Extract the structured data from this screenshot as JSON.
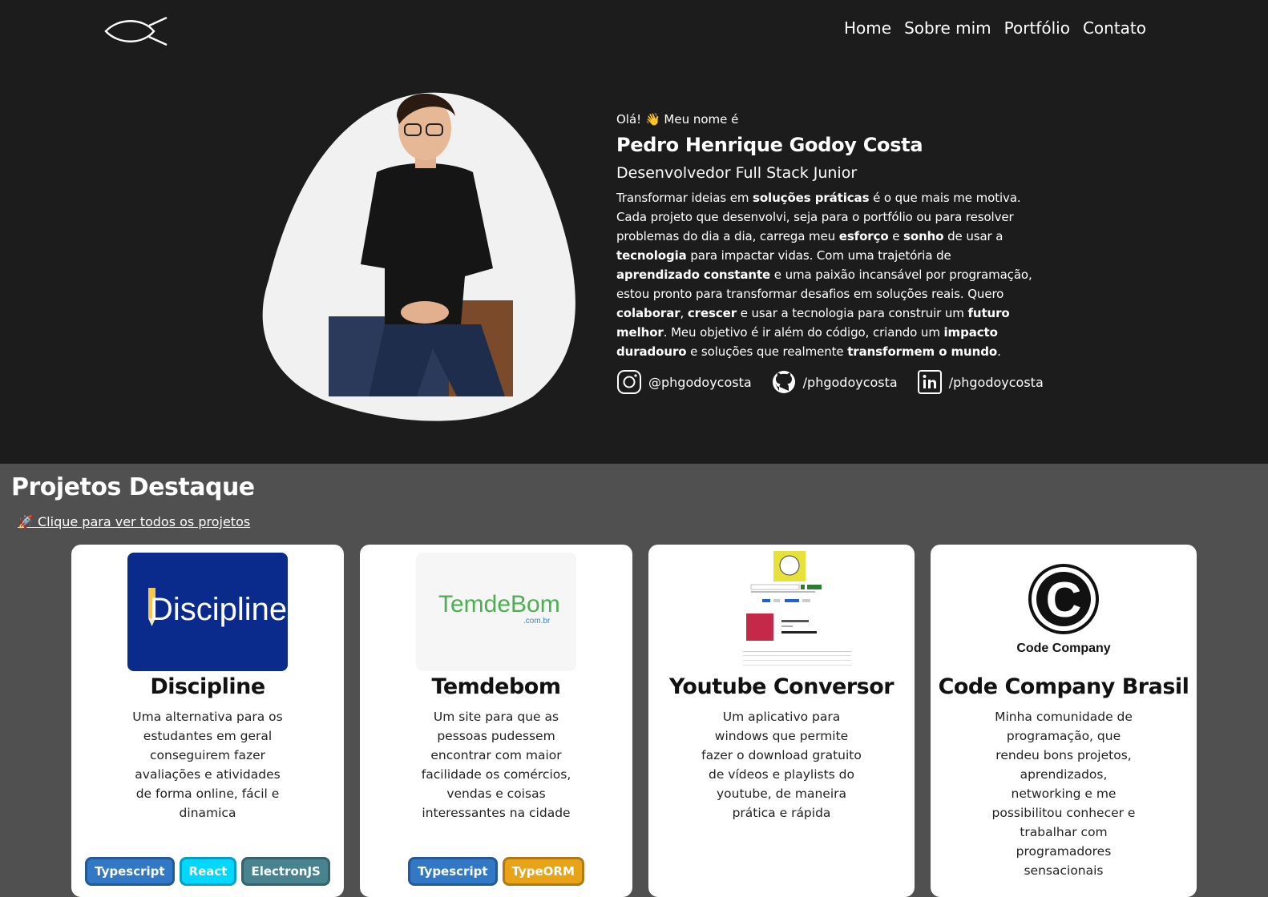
{
  "nav": {
    "items": [
      "Home",
      "Sobre mim",
      "Portfólio",
      "Contato"
    ]
  },
  "hero": {
    "greeting": "Olá! 👋 Meu nome é",
    "name": "Pedro Henrique Godoy Costa",
    "role": "Desenvolvedor Full Stack Junior",
    "bio": [
      {
        "t": "Transformar ideias em "
      },
      {
        "t": "soluções práticas",
        "b": true
      },
      {
        "t": " é o que mais me motiva. Cada projeto que desenvolvi, seja para o portfólio ou para resolver problemas do dia a dia, carrega meu "
      },
      {
        "t": "esforço",
        "b": true
      },
      {
        "t": " e "
      },
      {
        "t": "sonho",
        "b": true
      },
      {
        "t": " de usar a "
      },
      {
        "t": "tecnologia",
        "b": true
      },
      {
        "t": " para impactar vidas. Com uma trajetória de "
      },
      {
        "t": "aprendizado constante",
        "b": true
      },
      {
        "t": " e uma paixão incansável por programação, estou pronto para transformar desafios em soluções reais. Quero "
      },
      {
        "t": "colaborar",
        "b": true
      },
      {
        "t": ", "
      },
      {
        "t": "crescer",
        "b": true
      },
      {
        "t": " e usar a tecnologia para construir um "
      },
      {
        "t": "futuro melhor",
        "b": true
      },
      {
        "t": ". Meu objetivo é ir além do código, criando um "
      },
      {
        "t": "impacto duradouro",
        "b": true
      },
      {
        "t": " e soluções que realmente "
      },
      {
        "t": "transformem o mundo",
        "b": true
      },
      {
        "t": "."
      }
    ],
    "socials": {
      "instagram": "@phgodoycosta",
      "github": "/phgodoycosta",
      "linkedin": "/phgodoycosta"
    }
  },
  "projects": {
    "title": "Projetos Destaque",
    "see_all": "🚀 Clique para ver todos os projetos",
    "cards": [
      {
        "title": "Discipline",
        "description": "Uma alternativa para os estudantes em geral conseguirem fazer avaliações e atividades de forma online, fácil e dinamica",
        "logo_text": "Discipline",
        "tags": [
          {
            "label": "Typescript",
            "color": "#3178c6"
          },
          {
            "label": "React",
            "color": "#00d8ff"
          },
          {
            "label": "ElectronJS",
            "color": "#47848f"
          }
        ]
      },
      {
        "title": "Temdebom",
        "description": "Um site para que as pessoas pudessem encontrar com maior facilidade os comércios, vendas e coisas interessantes na cidade",
        "logo_text": "TemdeBom",
        "logo_sub": ".com.br",
        "tags": [
          {
            "label": "Typescript",
            "color": "#3178c6"
          },
          {
            "label": "TypeORM",
            "color": "#e8a317"
          }
        ]
      },
      {
        "title": "Youtube Conversor",
        "description": "Um aplicativo para windows que permite fazer o download gratuito de vídeos e playlists do youtube, de maneira prática e rápida",
        "tags": []
      },
      {
        "title": "Code Company Brasil",
        "description": "Minha comunidade de programação, que rendeu bons projetos, aprendizados, networking e me possibilitou conhecer e trabalhar com programadores sensacionais",
        "logo_text": "Code Company",
        "tags": []
      }
    ]
  }
}
